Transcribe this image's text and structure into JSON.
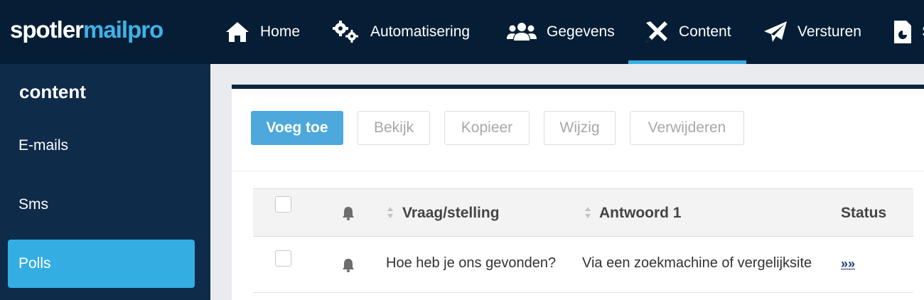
{
  "brand": {
    "part1": "spotler",
    "part2": "mailpro"
  },
  "nav": [
    {
      "label": "Home",
      "icon": "home-icon"
    },
    {
      "label": "Automatisering",
      "icon": "gears-icon"
    },
    {
      "label": "Gegevens",
      "icon": "users-icon"
    },
    {
      "label": "Content",
      "icon": "pencil-ruler-icon",
      "active": true
    },
    {
      "label": "Versturen",
      "icon": "paper-plane-icon"
    },
    {
      "label": "S",
      "icon": "report-icon"
    }
  ],
  "sidebar": {
    "title": "content",
    "items": [
      {
        "label": "E-mails"
      },
      {
        "label": "Sms"
      },
      {
        "label": "Polls",
        "active": true
      }
    ]
  },
  "toolbar": {
    "add": "Voeg toe",
    "view": "Bekijk",
    "copy": "Kopieer",
    "edit": "Wijzig",
    "delete": "Verwijderen"
  },
  "table": {
    "headers": {
      "question": "Vraag/stelling",
      "answer1": "Antwoord 1",
      "status": "Status"
    },
    "rows": [
      {
        "question": "Hoe heb je ons gevonden?",
        "answer1": "Via een zoekmachine of vergelijksite",
        "status_link": "»»"
      }
    ]
  },
  "colors": {
    "nav_bg": "#051e35",
    "sidebar_bg": "#0e2b4a",
    "accent": "#34ade3",
    "brand_blue": "#3fb3e8"
  }
}
